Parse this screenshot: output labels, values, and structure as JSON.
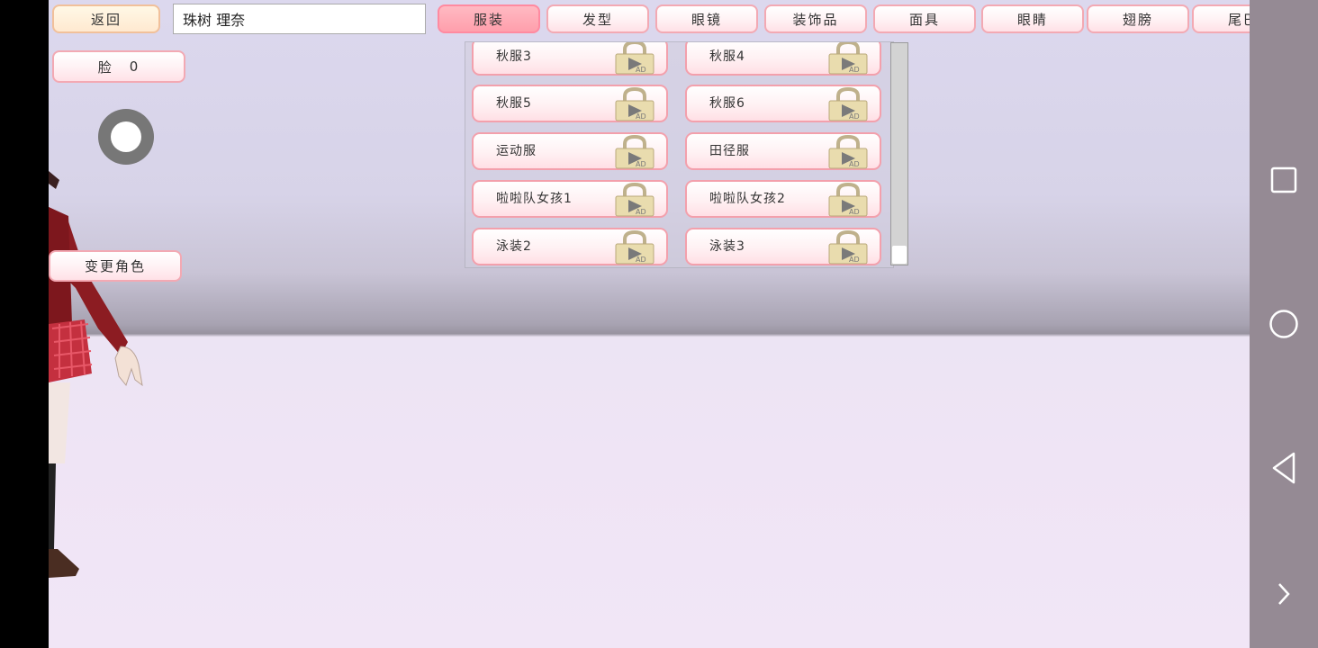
{
  "topbar": {
    "back_label": "返回",
    "name_value": "珠树 理奈",
    "tabs": [
      {
        "label": "服装",
        "active": true
      },
      {
        "label": "发型",
        "active": false
      },
      {
        "label": "眼镜",
        "active": false
      },
      {
        "label": "装饰品",
        "active": false
      },
      {
        "label": "面具",
        "active": false
      },
      {
        "label": "眼睛",
        "active": false
      },
      {
        "label": "翅膀",
        "active": false
      },
      {
        "label": "尾巴",
        "active": false
      }
    ]
  },
  "left": {
    "face_label": "脸",
    "face_value": "0",
    "change_character_label": "变更角色"
  },
  "outfits": [
    {
      "label": "秋服3",
      "locked": true
    },
    {
      "label": "秋服4",
      "locked": true
    },
    {
      "label": "秋服5",
      "locked": true
    },
    {
      "label": "秋服6",
      "locked": true
    },
    {
      "label": "运动服",
      "locked": true
    },
    {
      "label": "田径服",
      "locked": true
    },
    {
      "label": "啦啦队女孩1",
      "locked": true
    },
    {
      "label": "啦啦队女孩2",
      "locked": true
    },
    {
      "label": "泳装2",
      "locked": true
    },
    {
      "label": "泳装3",
      "locked": true
    }
  ],
  "lock_badge": "AD",
  "colors": {
    "button_border": "#f3a9b3",
    "active_tab": "#ff9fac",
    "nav_bar": "#958a94"
  },
  "icons": {
    "nav": [
      "recent-apps-icon",
      "home-icon",
      "back-icon",
      "expand-icon"
    ],
    "lock": "ad-lock-icon"
  }
}
